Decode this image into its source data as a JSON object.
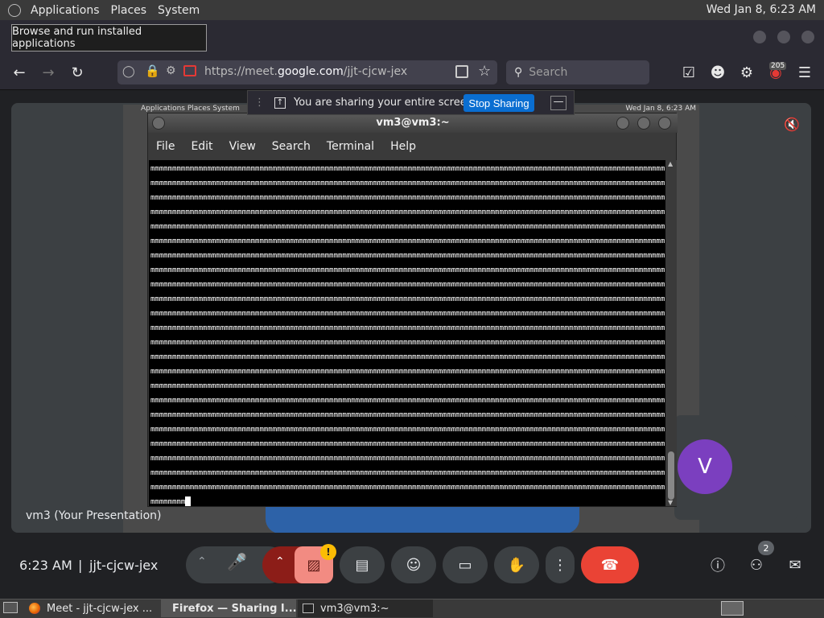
{
  "system_bar": {
    "menus": [
      "Applications",
      "Places",
      "System"
    ],
    "clock": "Wed Jan  8,  6:23 AM"
  },
  "tooltip": "Browse and run installed applications",
  "browser": {
    "url_prefix": "https://meet.",
    "url_domain": "google.com",
    "url_path": "/jjt-cjcw-jex",
    "search_placeholder": "Search",
    "extension_badge": "205"
  },
  "share_bar": {
    "message": "You are sharing your entire screen.",
    "stop_label": "Stop Sharing"
  },
  "terminal": {
    "title": "vm3@vm3:~",
    "menu": [
      "File",
      "Edit",
      "View",
      "Search",
      "Terminal",
      "Help"
    ],
    "line_char": "m",
    "line_length": 118,
    "full_lines": 23,
    "last_line": "mmmmmmmm"
  },
  "shared_preview": {
    "mini_menu": "Applications   Places   System",
    "mini_clock": "Wed Jan 8,  6:23 AM"
  },
  "meet": {
    "presentation_label": "vm3 (Your Presentation)",
    "participant_initial": "V",
    "time": "6:23 AM",
    "separator": "|",
    "meeting_code": "jjt-cjcw-jex",
    "people_count": "2",
    "warning_mark": "!"
  },
  "taskbar": {
    "items": [
      "Meet - jjt-cjcw-jex ...",
      "Firefox — Sharing I...",
      "vm3@vm3:~"
    ]
  },
  "colors": {
    "end_call": "#ea4335",
    "stop_sharing": "#0a6ed1",
    "avatar": "#7b3fbf",
    "warning": "#fbbc04"
  }
}
